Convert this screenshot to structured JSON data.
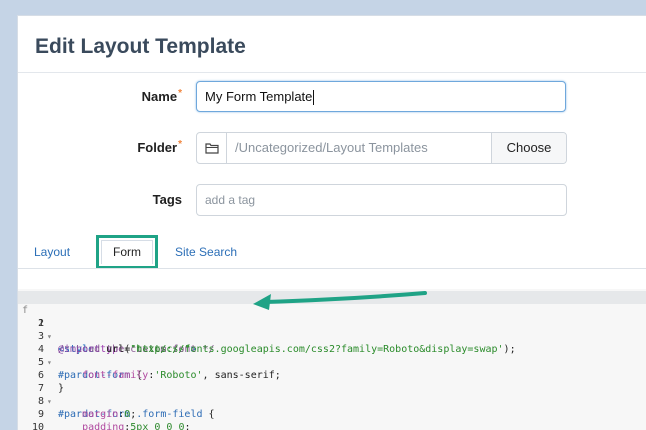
{
  "page": {
    "title": "Edit Layout Template"
  },
  "form": {
    "name": {
      "label": "Name",
      "required_mark": "*",
      "value": "My Form Template"
    },
    "folder": {
      "label": "Folder",
      "required_mark": "*",
      "path": "/Uncategorized/Layout Templates",
      "choose_label": "Choose"
    },
    "tags": {
      "label": "Tags",
      "placeholder": "add a tag"
    }
  },
  "tabs": [
    {
      "label": "Layout",
      "active": false
    },
    {
      "label": "Form",
      "active": true
    },
    {
      "label": "Site Search",
      "active": false
    }
  ],
  "code_editor": {
    "gutter_mark": "f",
    "lines": [
      {
        "num": "1",
        "fold": "▾",
        "text": "<style type=\"text/css\">"
      },
      {
        "num": "2",
        "fold": "▾",
        "text": "/* Load the custom font */"
      },
      {
        "num": "3",
        "fold": "",
        "text": "@import url('https://fonts.googleapis.com/css2?family=Roboto&display=swap');"
      },
      {
        "num": "4",
        "fold": "▾",
        "text": "#pardot-form {"
      },
      {
        "num": "5",
        "fold": "",
        "text": "    font-family:'Roboto', sans-serif;"
      },
      {
        "num": "6",
        "fold": "",
        "text": "}"
      },
      {
        "num": "7",
        "fold": "▾",
        "text": "#pardot-form .form-field {"
      },
      {
        "num": "8",
        "fold": "",
        "text": "    margin:0;"
      },
      {
        "num": "9",
        "fold": "",
        "text": "    padding:5px 0 0 0;"
      },
      {
        "num": "10",
        "fold": "",
        "text": "}"
      }
    ]
  },
  "annotation": {
    "highlight_color": "#1fa386",
    "arrow_color": "#1fa386"
  }
}
